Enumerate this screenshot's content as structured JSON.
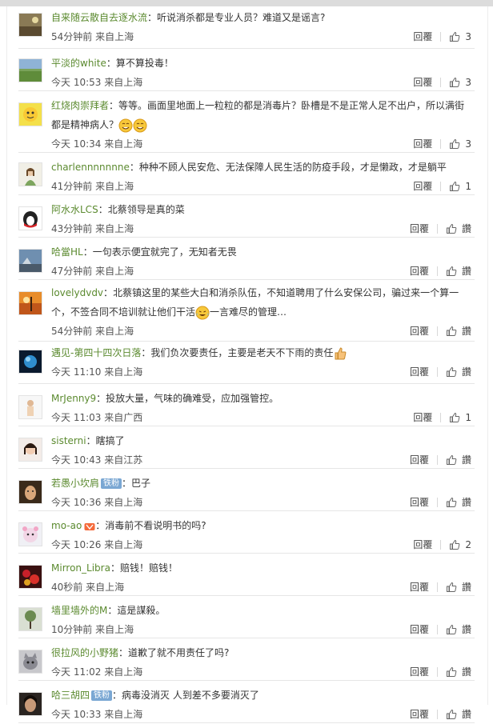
{
  "actions": {
    "reply_label": "回覆"
  },
  "colors": {
    "username": "#5b8a2f",
    "badge": "#7aa7d3"
  },
  "comments": [
    {
      "username": "自来随云散自去逐水流",
      "text": "听说消杀都是专业人员？难道又是谣言?",
      "time": "54分钟前 来自上海",
      "likes": "3",
      "avatar": "landscape"
    },
    {
      "username": "平淡的white",
      "text": "算不算投毒！",
      "time": "今天 10:53 来自上海",
      "likes": "3",
      "avatar": "field"
    },
    {
      "username": "红烧肉崇拜者",
      "text": "等等。画面里地面上一粒粒的都是消毒片？卧槽是不是正常人足不出户，所以满街都是精神病人？",
      "time": "今天 10:34 来自上海",
      "likes": "3",
      "avatar": "cartoon",
      "emoji": [
        "smile-emoji",
        "smile-emoji"
      ]
    },
    {
      "username": "charlennnnnnne",
      "text": "种种不顾人民安危、无法保障人民生活的防疫手段，才是懒政，才是躺平",
      "time": "41分钟前 来自上海",
      "likes": "1",
      "avatar": "girl"
    },
    {
      "username": "阿水水LCS",
      "text": "北蔡领导是真的菜",
      "time": "43分钟前 来自上海",
      "likes": "讚",
      "avatar": "penguin"
    },
    {
      "username": "哈當HL",
      "text": "一句表示便宜就完了，无知者无畏",
      "time": "47分钟前 来自上海",
      "likes": "讚",
      "avatar": "sky"
    },
    {
      "username": "lovelydvdv",
      "text": "北蔡镇这里的某些大白和消杀队伍，不知道聘用了什么安保公司，骗过来一个算一个，不签合同不培训就让他们干活",
      "text2": "一言难尽的管理…",
      "time": "54分钟前 来自上海",
      "likes": "讚",
      "avatar": "sunset",
      "emoji": [
        "laugh-cry-emoji"
      ]
    },
    {
      "username": "遇见-第四十四次日落",
      "text": "我们负次要责任，主要是老天不下雨的责任",
      "time": "今天 11:10 来自上海",
      "likes": "讚",
      "avatar": "planet",
      "emoji": [
        "thumbs-up-emoji"
      ]
    },
    {
      "username": "MrJenny9",
      "text": "投放大量，气味的确难受，应加强管控。",
      "time": "今天 11:03 来自广西",
      "likes": "1",
      "avatar": "person"
    },
    {
      "username": "sisterni",
      "text": "瞎搞了",
      "time": "今天 10:43 来自江苏",
      "likes": "讚",
      "avatar": "woman"
    },
    {
      "username": "若愚小坎肩",
      "badge": "铁粉",
      "text": "巴子",
      "time": "今天 10:36 来自上海",
      "likes": "讚",
      "avatar": "face"
    },
    {
      "username": "mo-ao",
      "vip": true,
      "text": "消毒前不看说明书的吗?",
      "time": "今天 10:26 来自上海",
      "likes": "2",
      "avatar": "bear"
    },
    {
      "username": "Mirron_Libra",
      "text": "赔钱！赔钱！",
      "time": "40秒前 来自上海",
      "likes": "讚",
      "avatar": "flowers"
    },
    {
      "username": "墙里墙外的M",
      "text": "這是謀殺。",
      "time": "10分钟前 来自上海",
      "likes": "讚",
      "avatar": "tree"
    },
    {
      "username": "很拉风的小野猪",
      "text": "道歉了就不用责任了吗?",
      "time": "今天 11:02 来自上海",
      "likes": "讚",
      "avatar": "cat"
    },
    {
      "username": "哈三胡四",
      "badge": "铁粉",
      "text": "病毒没消灭 人到差不多要消灭了",
      "time": "今天 10:33 来自上海",
      "likes": "讚",
      "avatar": "portrait"
    }
  ]
}
